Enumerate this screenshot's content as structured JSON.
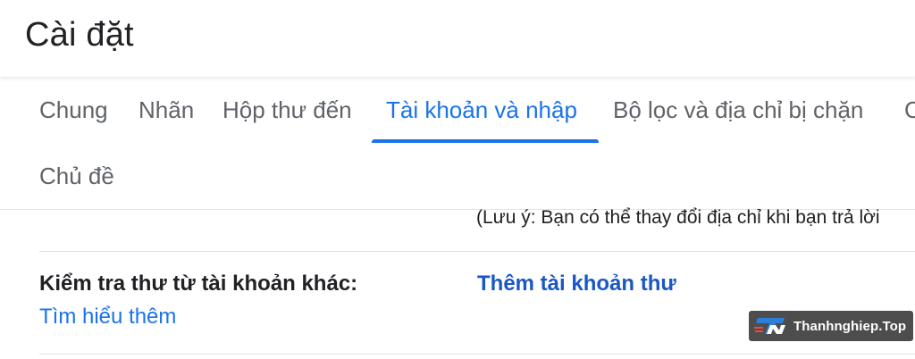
{
  "header": {
    "title": "Cài đặt"
  },
  "tabs": [
    {
      "label": "Chung",
      "active": false
    },
    {
      "label": "Nhãn",
      "active": false
    },
    {
      "label": "Hộp thư đến",
      "active": false
    },
    {
      "label": "Tài khoản và nhập",
      "active": true
    },
    {
      "label": "Bộ lọc và địa chỉ bị chặn",
      "active": false
    },
    {
      "label": "C",
      "active": false
    },
    {
      "label": "Chủ đề",
      "active": false
    }
  ],
  "content": {
    "note": "(Lưu ý: Bạn có thể thay đổi địa chỉ khi bạn trả lời",
    "check_mail": {
      "label": "Kiểm tra thư từ tài khoản khác:",
      "learn_more": "Tìm hiểu thêm",
      "action": "Thêm tài khoản thư"
    }
  },
  "watermark": {
    "text": "Thanhnghiep.Top",
    "logo": "TN"
  },
  "colors": {
    "accent": "#1a73e8",
    "link_bold": "#1a57c6",
    "watermark_bg": "#4d4d4d"
  }
}
